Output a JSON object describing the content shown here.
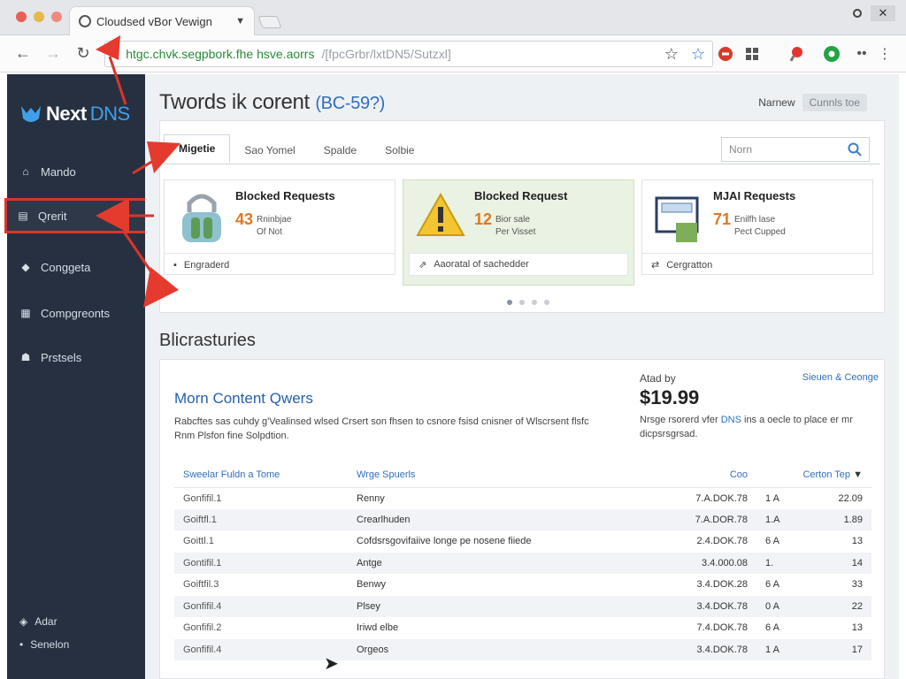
{
  "browser": {
    "tab_title": "Cloudsed vBor Vewign",
    "url_main": "htgc.chvk.segpbork.fhe hsve.aorrs",
    "url_rest": "/[fpcGrbr/lxtDN5/Sutzxl]",
    "colors": {
      "red": "#e95f55",
      "yellow": "#e8b84b",
      "green": "#5cb85c"
    }
  },
  "sidebar": {
    "brand": "Next",
    "brand_accent": "DNS",
    "items": [
      {
        "label": "Mando",
        "icon": "home-icon"
      },
      {
        "label": "Qrerit",
        "icon": "list-icon"
      },
      {
        "label": "Conggeta",
        "icon": "diamond-icon"
      },
      {
        "label": "Compgreonts",
        "icon": "grid-icon"
      },
      {
        "label": "Prstsels",
        "icon": "user-icon"
      }
    ],
    "bottom": [
      {
        "label": "Adar",
        "icon": "tag-icon"
      },
      {
        "label": "Senelon",
        "icon": "dot-icon"
      }
    ]
  },
  "header": {
    "title": "Twords ik corent",
    "title_sub": "(BC-59?)",
    "right_label": "Narnew",
    "right_pill": "Cunnls toe"
  },
  "tabs": [
    "Migetie",
    "Sao Yomel",
    "Spalde",
    "Solbie"
  ],
  "search": {
    "placeholder": "Norn"
  },
  "cards": [
    {
      "title": "Blocked Requests",
      "number": "43",
      "desc1": "Rninbjae",
      "desc2": "Of Not",
      "footer": "Engraderd",
      "icon": "lock-icon"
    },
    {
      "title": "Blocked Request",
      "number": "12",
      "desc1": "Bior sale",
      "desc2": "Per Visset",
      "footer": "Aaoratal of sachedder",
      "icon": "warning-icon"
    },
    {
      "title": "MJAI Requests",
      "number": "71",
      "desc1": "Enilfh lase",
      "desc2": "Pect Cupped",
      "footer": "Cergratton",
      "icon": "monitor-icon"
    }
  ],
  "section": {
    "title": "Blicrasturies",
    "card_title": "Morn Content Qwers",
    "card_desc": "Rabcftes sas cuhdy g'Vealinsed wlsed Crsert son fhsen to csnore fsisd cnisner of Wlscrsent flsfc Rnm Plsfon fine Solpdtion.",
    "price_label": "Atad by",
    "price": "$19.99",
    "price_desc_a": "Nrsge rsorerd vfer ",
    "price_desc_link": "DNS",
    "price_desc_b": " ins a oecle to place er mr dicpsrsgrsad.",
    "more_link": "Sieuen & Ceonge"
  },
  "table": {
    "headers": [
      "Sweelar Fuldn a Tome",
      "Wrge Spuerls",
      "Coo",
      "Certon Tep"
    ],
    "rows": [
      [
        "Gonfifil.1",
        "Renny",
        "7.A.DOK.78",
        "1 A",
        "22.09"
      ],
      [
        "Goiftfl.1",
        "Crearlhuden",
        "7.A.DOR.78",
        "1.A",
        "1.89"
      ],
      [
        "Goittl.1",
        "Cofdsrsgovifaiive longe pe nosene fiiede",
        "2.4.DOK.78",
        "6 A",
        "13"
      ],
      [
        "Gontifil.1",
        "Antge",
        "3.4.000.08",
        "1.",
        "14"
      ],
      [
        "Goiftfil.3",
        "Benwy",
        "3.4.DOK.28",
        "6 A",
        "33"
      ],
      [
        "Gonfifil.4",
        "Plsey",
        "3.4.DOK.78",
        "0 A",
        "22"
      ],
      [
        "Gonfifil.2",
        "Iriwd elbe",
        "7.4.DOK.78",
        "6 A",
        "13"
      ],
      [
        "Gonfifil.4",
        "Orgeos",
        "3.4.DOK.78",
        "1 A",
        "17"
      ]
    ]
  }
}
